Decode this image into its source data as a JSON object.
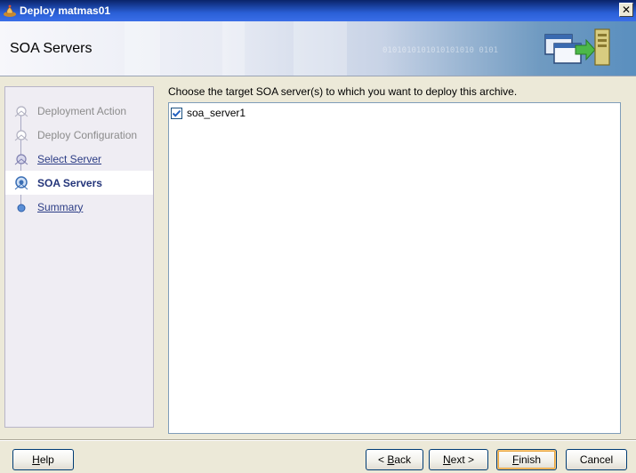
{
  "window": {
    "title": "Deploy matmas01",
    "close_symbol": "✕"
  },
  "banner": {
    "title": "SOA Servers",
    "binary_text": "0101010101010101010   0101",
    "icon": "deploy-servers-icon"
  },
  "nav": {
    "items": [
      {
        "label": "Deployment Action",
        "state": "disabled"
      },
      {
        "label": "Deploy Configuration",
        "state": "disabled"
      },
      {
        "label": "Select Server",
        "state": "link"
      },
      {
        "label": "SOA Servers",
        "state": "active"
      },
      {
        "label": "Summary",
        "state": "link"
      }
    ]
  },
  "content": {
    "instruction": "Choose the target SOA server(s) to which you want to deploy this archive.",
    "servers": [
      {
        "label": "soa_server1",
        "checked": true
      }
    ]
  },
  "buttons": {
    "help": {
      "label": "Help",
      "mnemonic": "H"
    },
    "back": {
      "label": "< Back",
      "mnemonic": "B"
    },
    "next": {
      "label": "Next >",
      "mnemonic": "N"
    },
    "finish": {
      "label": "Finish",
      "mnemonic": "F"
    },
    "cancel": {
      "label": "Cancel"
    }
  },
  "colors": {
    "titlebar": "#0a246a",
    "accent": "#2b3c85",
    "checkbox_check": "#2060c0"
  }
}
